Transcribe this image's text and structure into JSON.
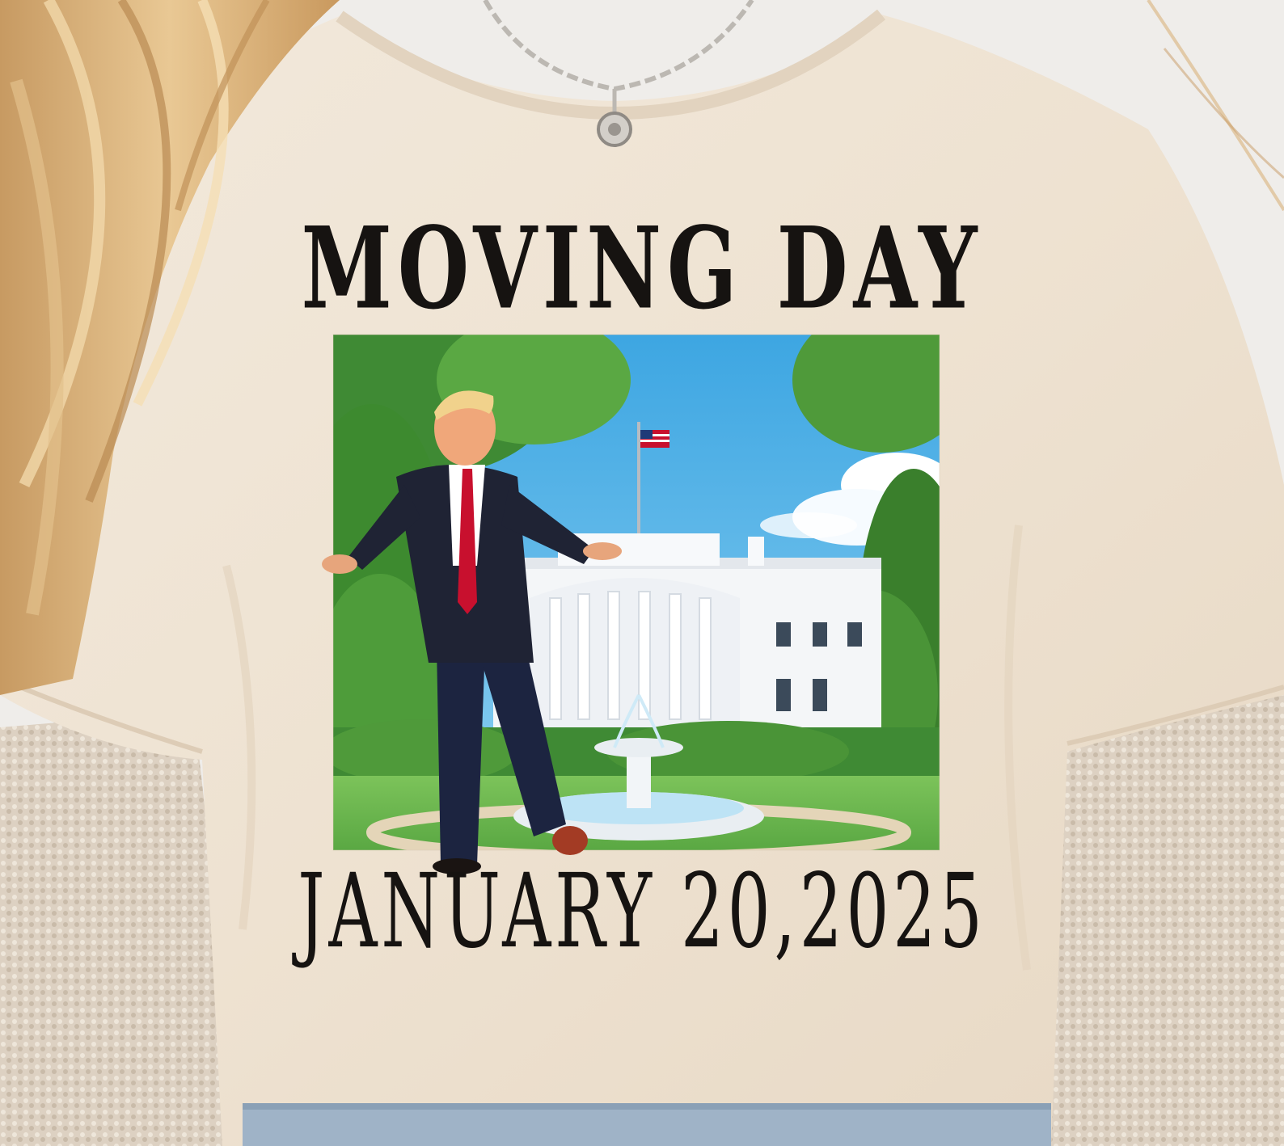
{
  "shirt_print": {
    "headline": "MOVING DAY",
    "date": "JANUARY 20,2025"
  },
  "colors": {
    "shirt": "#efe3d3",
    "print_ink": "#161311",
    "hair": "#d9b27c",
    "sky": "#55b3e6",
    "foliage": "#4f9a3a",
    "building": "#f4f6f8",
    "suit": "#1f2334",
    "tie": "#c8102e",
    "sweater": "#ddd1c2"
  },
  "scene_items": [
    "necklace",
    "white-house-illustration",
    "fountain",
    "flag",
    "man-in-suit",
    "blonde-hair",
    "knit-sweater"
  ]
}
